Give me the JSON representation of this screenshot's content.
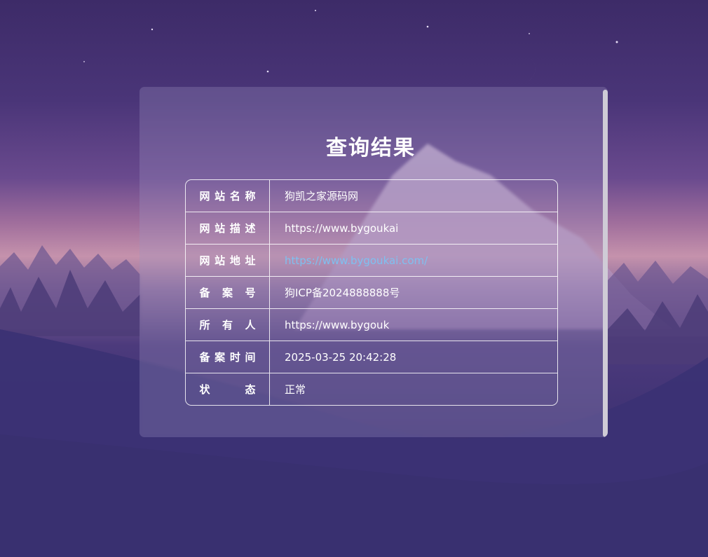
{
  "result": {
    "title": "查询结果",
    "rows": [
      {
        "label": "网站名称",
        "value": "狗凯之家源码网"
      },
      {
        "label": "网站描述",
        "value": "https://www.bygoukai"
      },
      {
        "label": "网站地址",
        "value": "https://www.bygoukai.com/"
      },
      {
        "label": "备案号",
        "value": "狗ICP备2024888888号"
      },
      {
        "label": "所有人",
        "value": "https://www.bygouk"
      },
      {
        "label": "备案时间",
        "value": "2025-03-25 20:42:28"
      },
      {
        "label": "状态",
        "value": "正常"
      }
    ]
  },
  "colors": {
    "link": "#7ec0f0",
    "text": "#ffffff",
    "panel": "rgba(160,148,196,0.30)"
  },
  "icons": {
    "moon": "crescent-moon-icon"
  }
}
